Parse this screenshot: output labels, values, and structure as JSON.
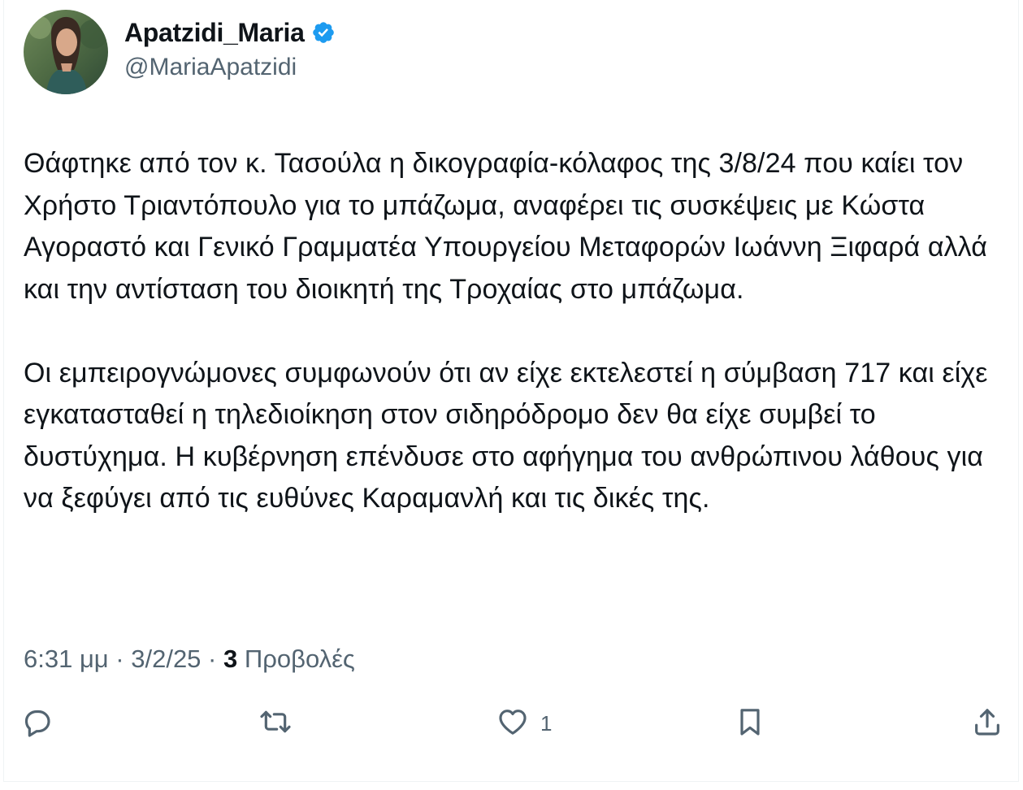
{
  "author": {
    "display_name": "Apatzidi_Maria",
    "handle": "@MariaApatzidi",
    "verified": true
  },
  "tweet": {
    "paragraphs": [
      "Θάφτηκε από τον κ. Τασούλα η δικογραφία-κόλαφος της 3/8/24 που καίει τον Χρήστο Τριαντόπουλο για το μπάζωμα, αναφέρει τις συσκέψεις με Κώστα Αγοραστό και Γενικό Γραμματέα Υπουργείου Μεταφορών Ιωάννη Ξιφαρά αλλά και την αντίσταση του διοικητή της Τροχαίας στο μπάζωμα.",
      "Οι εμπειρογνώμονες συμφωνούν ότι αν είχε εκτελεστεί η σύμβαση 717 και είχε εγκατασταθεί η τηλεδιοίκηση στον σιδηρόδρομο δεν θα είχε συμβεί το δυστύχημα. Η κυβέρνηση επένδυσε στο αφήγημα του ανθρώπινου λάθους για να ξεφύγει από τις ευθύνες Καραμανλή και τις δικές της."
    ]
  },
  "meta": {
    "time": "6:31 μμ",
    "separator": " · ",
    "date": "3/2/25",
    "views_count": "3",
    "views_label": " Προβολές"
  },
  "actions": {
    "reply_count": "",
    "retweet_count": "",
    "like_count": "1",
    "bookmark_count": ""
  },
  "icons": {
    "reply": "reply-icon",
    "retweet": "retweet-icon",
    "like": "heart-icon",
    "bookmark": "bookmark-icon",
    "share": "share-icon",
    "verified": "verified-badge-icon"
  },
  "colors": {
    "text_primary": "#0f1419",
    "text_secondary": "#536471",
    "verified_blue": "#1d9bf0",
    "border": "#eff3f4"
  }
}
